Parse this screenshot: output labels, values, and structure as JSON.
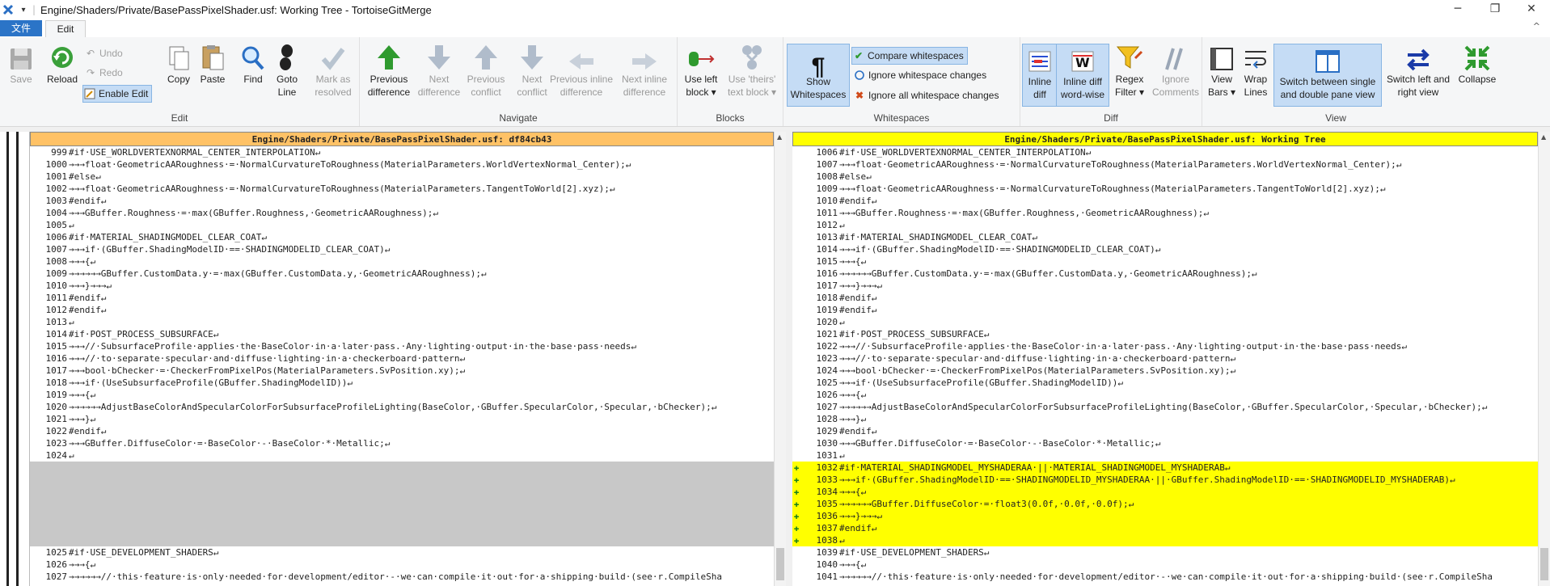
{
  "window": {
    "title": "Engine/Shaders/Private/BasePassPixelShader.usf: Working Tree - TortoiseGitMerge",
    "minimize": "─",
    "restore": "❐",
    "close": "✕"
  },
  "ribbon_tabs": {
    "file": "文件",
    "edit": "Edit",
    "collapse": "^"
  },
  "groups": {
    "edit": {
      "label": "Edit",
      "save": "Save",
      "reload": "Reload",
      "undo": "Undo",
      "redo": "Redo",
      "enable_edit": "Enable Edit",
      "copy": "Copy",
      "paste": "Paste",
      "find": "Find",
      "goto_line": [
        "Goto",
        "Line"
      ],
      "mark_resolved": [
        "Mark as",
        "resolved"
      ]
    },
    "navigate": {
      "label": "Navigate",
      "prev_diff": [
        "Previous",
        "difference"
      ],
      "next_diff": [
        "Next",
        "difference"
      ],
      "prev_conflict": [
        "Previous",
        "conflict"
      ],
      "next_conflict": [
        "Next",
        "conflict"
      ],
      "prev_inline": [
        "Previous inline",
        "difference"
      ],
      "next_inline": [
        "Next inline",
        "difference"
      ]
    },
    "blocks": {
      "label": "Blocks",
      "use_left": [
        "Use left",
        "block ▾"
      ],
      "use_theirs": [
        "Use 'theirs'",
        "text block ▾"
      ]
    },
    "whitespaces": {
      "label": "Whitespaces",
      "show": [
        "Show",
        "Whitespaces"
      ],
      "compare": "Compare whitespaces",
      "ignore_changes": "Ignore whitespace changes",
      "ignore_all": "Ignore all whitespace changes"
    },
    "diff": {
      "label": "Diff",
      "inline": [
        "Inline",
        "diff"
      ],
      "inline_ww": [
        "Inline diff",
        "word-wise"
      ],
      "regex": [
        "Regex",
        "Filter ▾"
      ],
      "ignore_comments": [
        "Ignore",
        "Comments"
      ]
    },
    "view": {
      "label": "View",
      "view_bars": [
        "View",
        "Bars ▾"
      ],
      "wrap": [
        "Wrap",
        "Lines"
      ],
      "switch_pane": [
        "Switch between single",
        "and double pane view"
      ],
      "switch_lr": [
        "Switch left and",
        "right view"
      ],
      "collapse": "Collapse"
    }
  },
  "left_pane": {
    "header": "Engine/Shaders/Private/BasePassPixelShader.usf: df84cb43",
    "lines": [
      {
        "n": "999",
        "t": "#if·USE_WORLDVERTEXNORMAL_CENTER_INTERPOLATION↵"
      },
      {
        "n": "1000",
        "t": "→→→float·GeometricAARoughness·=·NormalCurvatureToRoughness(MaterialParameters.WorldVertexNormal_Center);↵"
      },
      {
        "n": "1001",
        "t": "#else↵"
      },
      {
        "n": "1002",
        "t": "→→→float·GeometricAARoughness·=·NormalCurvatureToRoughness(MaterialParameters.TangentToWorld[2].xyz);↵"
      },
      {
        "n": "1003",
        "t": "#endif↵"
      },
      {
        "n": "1004",
        "t": "→→→GBuffer.Roughness·=·max(GBuffer.Roughness,·GeometricAARoughness);↵"
      },
      {
        "n": "1005",
        "t": "↵"
      },
      {
        "n": "1006",
        "t": "#if·MATERIAL_SHADINGMODEL_CLEAR_COAT↵"
      },
      {
        "n": "1007",
        "t": "→→→if·(GBuffer.ShadingModelID·==·SHADINGMODELID_CLEAR_COAT)↵"
      },
      {
        "n": "1008",
        "t": "→→→{↵"
      },
      {
        "n": "1009",
        "t": "→→→→→→GBuffer.CustomData.y·=·max(GBuffer.CustomData.y,·GeometricAARoughness);↵"
      },
      {
        "n": "1010",
        "t": "→→→}→→→↵"
      },
      {
        "n": "1011",
        "t": "#endif↵"
      },
      {
        "n": "1012",
        "t": "#endif↵"
      },
      {
        "n": "1013",
        "t": "↵"
      },
      {
        "n": "1014",
        "t": "#if·POST_PROCESS_SUBSURFACE↵"
      },
      {
        "n": "1015",
        "t": "→→→//·SubsurfaceProfile·applies·the·BaseColor·in·a·later·pass.·Any·lighting·output·in·the·base·pass·needs↵"
      },
      {
        "n": "1016",
        "t": "→→→//·to·separate·specular·and·diffuse·lighting·in·a·checkerboard·pattern↵"
      },
      {
        "n": "1017",
        "t": "→→→bool·bChecker·=·CheckerFromPixelPos(MaterialParameters.SvPosition.xy);↵"
      },
      {
        "n": "1018",
        "t": "→→→if·(UseSubsurfaceProfile(GBuffer.ShadingModelID))↵"
      },
      {
        "n": "1019",
        "t": "→→→{↵"
      },
      {
        "n": "1020",
        "t": "→→→→→→AdjustBaseColorAndSpecularColorForSubsurfaceProfileLighting(BaseColor,·GBuffer.SpecularColor,·Specular,·bChecker);↵"
      },
      {
        "n": "1021",
        "t": "→→→}↵"
      },
      {
        "n": "1022",
        "t": "#endif↵"
      },
      {
        "n": "1023",
        "t": "→→→GBuffer.DiffuseColor·=·BaseColor·-·BaseColor·*·Metallic;↵"
      },
      {
        "n": "1024",
        "t": "↵"
      },
      {
        "n": "",
        "t": "",
        "gap": true
      },
      {
        "n": "",
        "t": "",
        "gap": true
      },
      {
        "n": "",
        "t": "",
        "gap": true
      },
      {
        "n": "",
        "t": "",
        "gap": true
      },
      {
        "n": "",
        "t": "",
        "gap": true
      },
      {
        "n": "",
        "t": "",
        "gap": true
      },
      {
        "n": "",
        "t": "",
        "gap": true
      },
      {
        "n": "1025",
        "t": "#if·USE_DEVELOPMENT_SHADERS↵"
      },
      {
        "n": "1026",
        "t": "→→→{↵"
      },
      {
        "n": "1027",
        "t": "→→→→→→//·this·feature·is·only·needed·for·development/editor·-·we·can·compile·it·out·for·a·shipping·build·(see·r.CompileSha"
      }
    ]
  },
  "right_pane": {
    "header": "Engine/Shaders/Private/BasePassPixelShader.usf: Working Tree",
    "lines": [
      {
        "n": "1006",
        "t": "#if·USE_WORLDVERTEXNORMAL_CENTER_INTERPOLATION↵"
      },
      {
        "n": "1007",
        "t": "→→→float·GeometricAARoughness·=·NormalCurvatureToRoughness(MaterialParameters.WorldVertexNormal_Center);↵"
      },
      {
        "n": "1008",
        "t": "#else↵"
      },
      {
        "n": "1009",
        "t": "→→→float·GeometricAARoughness·=·NormalCurvatureToRoughness(MaterialParameters.TangentToWorld[2].xyz);↵"
      },
      {
        "n": "1010",
        "t": "#endif↵"
      },
      {
        "n": "1011",
        "t": "→→→GBuffer.Roughness·=·max(GBuffer.Roughness,·GeometricAARoughness);↵"
      },
      {
        "n": "1012",
        "t": "↵"
      },
      {
        "n": "1013",
        "t": "#if·MATERIAL_SHADINGMODEL_CLEAR_COAT↵"
      },
      {
        "n": "1014",
        "t": "→→→if·(GBuffer.ShadingModelID·==·SHADINGMODELID_CLEAR_COAT)↵"
      },
      {
        "n": "1015",
        "t": "→→→{↵"
      },
      {
        "n": "1016",
        "t": "→→→→→→GBuffer.CustomData.y·=·max(GBuffer.CustomData.y,·GeometricAARoughness);↵"
      },
      {
        "n": "1017",
        "t": "→→→}→→→↵"
      },
      {
        "n": "1018",
        "t": "#endif↵"
      },
      {
        "n": "1019",
        "t": "#endif↵"
      },
      {
        "n": "1020",
        "t": "↵"
      },
      {
        "n": "1021",
        "t": "#if·POST_PROCESS_SUBSURFACE↵"
      },
      {
        "n": "1022",
        "t": "→→→//·SubsurfaceProfile·applies·the·BaseColor·in·a·later·pass.·Any·lighting·output·in·the·base·pass·needs↵"
      },
      {
        "n": "1023",
        "t": "→→→//·to·separate·specular·and·diffuse·lighting·in·a·checkerboard·pattern↵"
      },
      {
        "n": "1024",
        "t": "→→→bool·bChecker·=·CheckerFromPixelPos(MaterialParameters.SvPosition.xy);↵"
      },
      {
        "n": "1025",
        "t": "→→→if·(UseSubsurfaceProfile(GBuffer.ShadingModelID))↵"
      },
      {
        "n": "1026",
        "t": "→→→{↵"
      },
      {
        "n": "1027",
        "t": "→→→→→→AdjustBaseColorAndSpecularColorForSubsurfaceProfileLighting(BaseColor,·GBuffer.SpecularColor,·Specular,·bChecker);↵"
      },
      {
        "n": "1028",
        "t": "→→→}↵"
      },
      {
        "n": "1029",
        "t": "#endif↵"
      },
      {
        "n": "1030",
        "t": "→→→GBuffer.DiffuseColor·=·BaseColor·-·BaseColor·*·Metallic;↵"
      },
      {
        "n": "1031",
        "t": "↵"
      },
      {
        "n": "1032",
        "t": "#if·MATERIAL_SHADINGMODEL_MYSHADERAA·||·MATERIAL_SHADINGMODEL_MYSHADERAB↵",
        "added": true
      },
      {
        "n": "1033",
        "t": "→→→if·(GBuffer.ShadingModelID·==·SHADINGMODELID_MYSHADERAA·||·GBuffer.ShadingModelID·==·SHADINGMODELID_MYSHADERAB)↵",
        "added": true
      },
      {
        "n": "1034",
        "t": "→→→{↵",
        "added": true
      },
      {
        "n": "1035",
        "t": "→→→→→→GBuffer.DiffuseColor·=·float3(0.0f,·0.0f,·0.0f);↵",
        "added": true
      },
      {
        "n": "1036",
        "t": "→→→}→→→↵",
        "added": true
      },
      {
        "n": "1037",
        "t": "#endif↵",
        "added": true
      },
      {
        "n": "1038",
        "t": "↵",
        "added": true
      },
      {
        "n": "1039",
        "t": "#if·USE_DEVELOPMENT_SHADERS↵"
      },
      {
        "n": "1040",
        "t": "→→→{↵"
      },
      {
        "n": "1041",
        "t": "→→→→→→//·this·feature·is·only·needed·for·development/editor·-·we·can·compile·it·out·for·a·shipping·build·(see·r.CompileSha"
      }
    ]
  },
  "colors": {
    "left_header": "#ffc266",
    "right_header": "#ffff00",
    "added": "#ffff00",
    "gap": "#c8c8c8"
  }
}
